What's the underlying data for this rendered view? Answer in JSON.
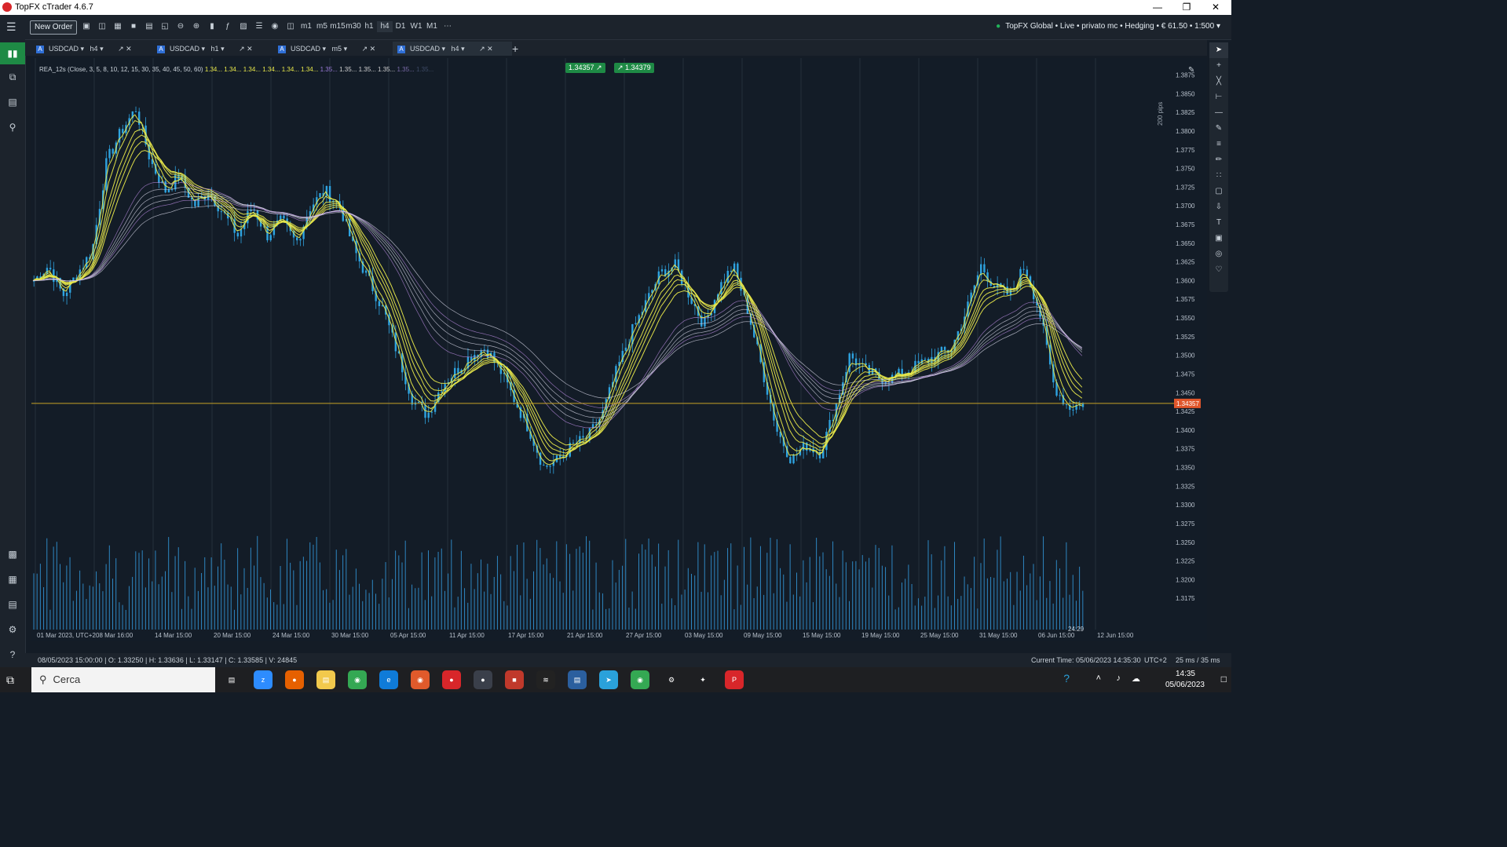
{
  "window": {
    "title": "TopFX cTrader 4.6.7"
  },
  "toolbar": {
    "new_order": "New Order",
    "timeframes": [
      "m1",
      "m5",
      "m15",
      "m30",
      "h1",
      "h4",
      "D1",
      "W1",
      "M1"
    ],
    "account": "TopFX Global • Live • privato mc • Hedging • € 61.50 • 1:500"
  },
  "tabs": [
    {
      "symbol": "USDCAD",
      "tf": "h4"
    },
    {
      "symbol": "USDCAD",
      "tf": "h1"
    },
    {
      "symbol": "USDCAD",
      "tf": "m5"
    },
    {
      "symbol": "USDCAD",
      "tf": "h4"
    }
  ],
  "chart": {
    "indicator": "REA_12s (Close, 3, 5, 8, 10, 12, 15, 30, 35, 40, 45, 50, 60)",
    "indicator_values": [
      "1.34...",
      "1.34...",
      "1.34...",
      "1.34...",
      "1.34...",
      "1.34...",
      "1.35...",
      "1.35...",
      "1.35...",
      "1.35...",
      "1.35...",
      "1.35..."
    ],
    "indicator_colors": [
      "#e8e84a",
      "#e8e84a",
      "#e8e84a",
      "#e8e84a",
      "#e8e84a",
      "#e8e84a",
      "#9a7ad8",
      "#d0d0d0",
      "#d0d0d0",
      "#d0d0d0",
      "#7a6aa8",
      "#3d4a66"
    ],
    "sell_price": "1.34357",
    "buy_price": "1.34379",
    "pips_label": "200 pips",
    "current_price_label": "1.34357",
    "countdown": "24:29",
    "colors": {
      "bull": "#2ea3e0",
      "bear": "#2ea3e0",
      "ma_fast": "#e8e84a",
      "ma_slow": "#d8d8e8",
      "ma_purple": "#b98be0",
      "price_line": "#c9a227",
      "volume": "#2e86c1"
    }
  },
  "chart_data": {
    "type": "candlestick",
    "symbol": "USDCAD",
    "timeframe": "h4",
    "price_ticks": [
      "1.3875",
      "1.3850",
      "1.3825",
      "1.3800",
      "1.3775",
      "1.3750",
      "1.3725",
      "1.3700",
      "1.3675",
      "1.3650",
      "1.3625",
      "1.3600",
      "1.3575",
      "1.3550",
      "1.3525",
      "1.3500",
      "1.3475",
      "1.3450",
      "1.3425",
      "1.3400",
      "1.3375",
      "1.3350",
      "1.3325",
      "1.3300",
      "1.3275",
      "1.3250",
      "1.3225",
      "1.3200",
      "1.3175"
    ],
    "ylim": [
      1.315,
      1.3885
    ],
    "time_ticks": [
      "01 Mar 2023, UTC+2",
      "08 Mar 16:00",
      "14 Mar 15:00",
      "20 Mar 15:00",
      "24 Mar 15:00",
      "30 Mar 15:00",
      "05 Apr 15:00",
      "11 Apr 15:00",
      "17 Apr 15:00",
      "21 Apr 15:00",
      "27 Apr 15:00",
      "03 May 15:00",
      "09 May 15:00",
      "15 May 15:00",
      "19 May 15:00",
      "25 May 15:00",
      "31 May 15:00",
      "06 Jun 15:00",
      "12 Jun 15:00"
    ],
    "price_path": [
      1.36,
      1.362,
      1.358,
      1.361,
      1.364,
      1.376,
      1.38,
      1.383,
      1.376,
      1.372,
      1.374,
      1.37,
      1.372,
      1.369,
      1.366,
      1.37,
      1.366,
      1.368,
      1.365,
      1.37,
      1.372,
      1.37,
      1.364,
      1.36,
      1.356,
      1.35,
      1.344,
      1.342,
      1.346,
      1.348,
      1.35,
      1.351,
      1.348,
      1.344,
      1.34,
      1.335,
      1.336,
      1.338,
      1.339,
      1.342,
      1.348,
      1.353,
      1.357,
      1.361,
      1.362,
      1.358,
      1.354,
      1.359,
      1.362,
      1.356,
      1.348,
      1.34,
      1.336,
      1.338,
      1.337,
      1.343,
      1.35,
      1.348,
      1.347,
      1.347,
      1.348,
      1.349,
      1.35,
      1.351,
      1.356,
      1.362,
      1.359,
      1.358,
      1.362,
      1.356,
      1.346,
      1.343,
      1.3436
    ]
  },
  "status": {
    "bar_info": "08/05/2023 15:00:00 | O: 1.33250 | H: 1.33636 | L: 1.33147 | C: 1.33585 | V: 24845",
    "current_time": "Current Time: 05/06/2023 14:35:30",
    "tz": "UTC+2",
    "latency": "25 ms / 35 ms"
  },
  "taskbar": {
    "search_placeholder": "Cerca",
    "time": "14:35",
    "date": "05/06/2023"
  }
}
